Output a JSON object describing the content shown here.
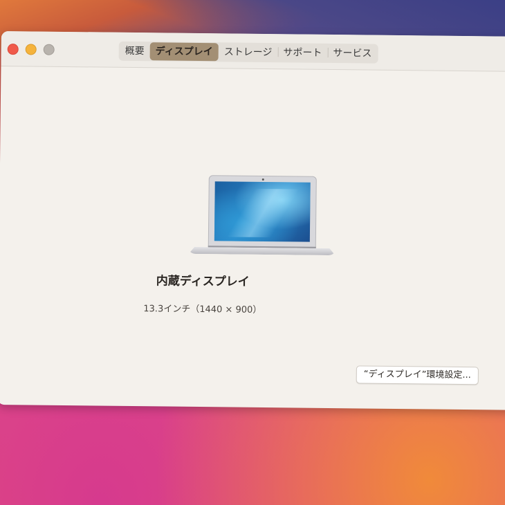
{
  "tabs": [
    {
      "label": "概要",
      "active": false
    },
    {
      "label": "ディスプレイ",
      "active": true
    },
    {
      "label": "ストレージ",
      "active": false
    },
    {
      "label": "サポート",
      "active": false
    },
    {
      "label": "サービス",
      "active": false
    }
  ],
  "display": {
    "title": "内蔵ディスプレイ",
    "spec": "13.3インチ（1440 × 900）",
    "preferences_button": "“ディスプレイ”環境設定..."
  },
  "colors": {
    "close": "#f05a4a",
    "minimize": "#f5b33c",
    "zoom": "#b8b3ad",
    "active_tab": "#a38f74"
  },
  "icons": {
    "laptop": "macbook-air-icon"
  }
}
